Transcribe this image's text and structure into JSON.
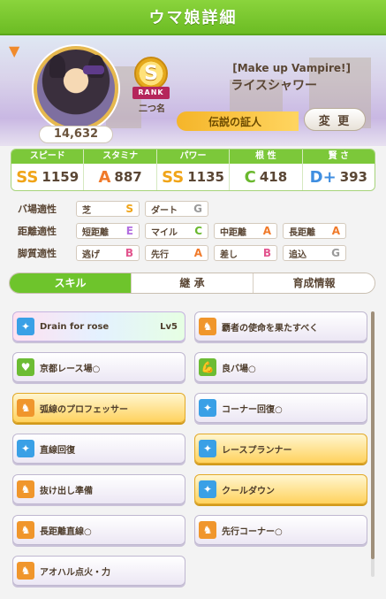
{
  "header": {
    "title": "ウマ娘詳細"
  },
  "profile": {
    "points": "14,632",
    "rank": "S",
    "rank_label": "RANK",
    "nickname": "二つ名",
    "subtitle": "[Make up Vampire!]",
    "name": "ライスシャワー",
    "title": "伝説の証人",
    "change_label": "変 更"
  },
  "stats": [
    {
      "label": "スピード",
      "grade": "SS",
      "value": "1159"
    },
    {
      "label": "スタミナ",
      "grade": "A",
      "value": "887"
    },
    {
      "label": "パワー",
      "grade": "SS",
      "value": "1135"
    },
    {
      "label": "根 性",
      "grade": "C",
      "value": "418"
    },
    {
      "label": "賢 さ",
      "grade": "D+",
      "value": "393"
    }
  ],
  "aptitude": {
    "track": {
      "label": "バ場適性",
      "items": [
        {
          "name": "芝",
          "grade": "S"
        },
        {
          "name": "ダート",
          "grade": "G"
        }
      ]
    },
    "distance": {
      "label": "距離適性",
      "items": [
        {
          "name": "短距離",
          "grade": "E"
        },
        {
          "name": "マイル",
          "grade": "C"
        },
        {
          "name": "中距離",
          "grade": "A"
        },
        {
          "name": "長距離",
          "grade": "A"
        }
      ]
    },
    "style": {
      "label": "脚質適性",
      "items": [
        {
          "name": "逃げ",
          "grade": "B"
        },
        {
          "name": "先行",
          "grade": "A"
        },
        {
          "name": "差し",
          "grade": "B"
        },
        {
          "name": "追込",
          "grade": "G"
        }
      ]
    }
  },
  "tabs": [
    "スキル",
    "継 承",
    "育成情報"
  ],
  "skills": [
    {
      "name": "Drain for rose",
      "level": "Lv5",
      "icon": "sparkle-icon",
      "style": "rainbow"
    },
    {
      "name": "覇者の使命を果たすべく",
      "icon": "horse-icon",
      "style": "normal"
    },
    {
      "name": "京都レース場○",
      "icon": "heart-icon",
      "style": "normal"
    },
    {
      "name": "良バ場○",
      "icon": "bicep-icon",
      "style": "normal"
    },
    {
      "name": "弧線のプロフェッサー",
      "icon": "horse-icon",
      "style": "gold"
    },
    {
      "name": "コーナー回復○",
      "icon": "sparkle-icon",
      "style": "normal"
    },
    {
      "name": "直線回復",
      "icon": "sparkle-icon",
      "style": "normal"
    },
    {
      "name": "レースプランナー",
      "icon": "sparkle-icon",
      "style": "gold"
    },
    {
      "name": "抜け出し準備",
      "icon": "horse-icon",
      "style": "normal"
    },
    {
      "name": "クールダウン",
      "icon": "sparkle-icon",
      "style": "gold"
    },
    {
      "name": "長距離直線○",
      "icon": "horse-icon",
      "style": "normal"
    },
    {
      "name": "先行コーナー○",
      "icon": "horse-icon",
      "style": "normal"
    },
    {
      "name": "アオハル点火・力",
      "icon": "horse-icon",
      "style": "normal"
    }
  ],
  "colors": {
    "green_accent": "#6ec42c",
    "grade_S": "#f0a418",
    "grade_A": "#f07a2a",
    "grade_B": "#e2558e",
    "grade_C": "#6ab82e",
    "grade_D": "#3f8ee0",
    "grade_E": "#b36fe0",
    "grade_G": "#9a9a9a"
  }
}
